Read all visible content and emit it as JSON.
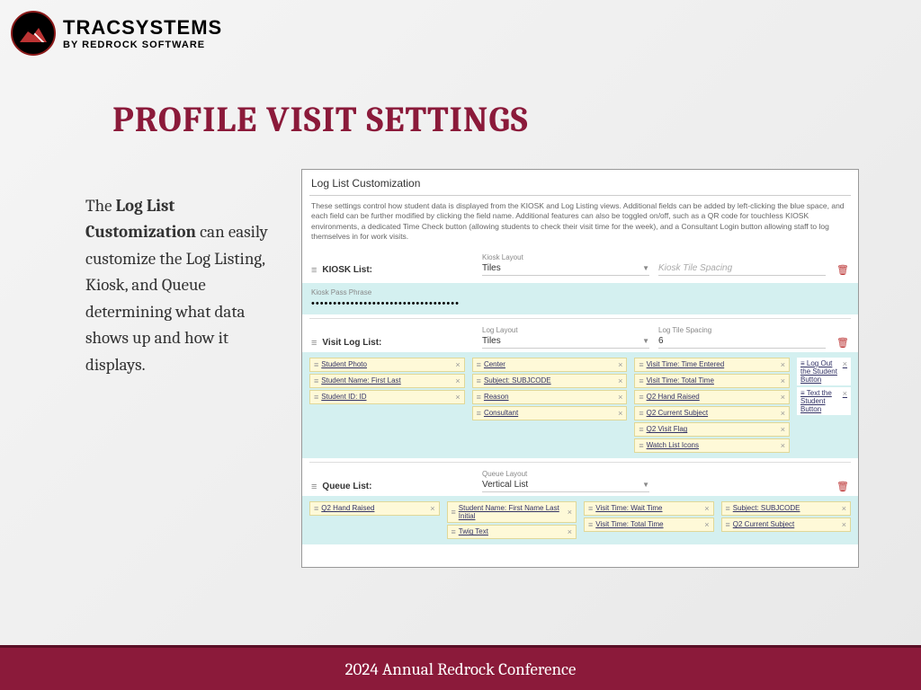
{
  "logo": {
    "main": "TRACSYSTEMS",
    "sub": "BY REDROCK SOFTWARE"
  },
  "title": "PROFILE VISIT SETTINGS",
  "body": {
    "pre": "The ",
    "bold": "Log List Customization",
    "post": " can easily customize the Log Listing, Kiosk, and Queue determining what data shows up and how it displays."
  },
  "panel": {
    "title": "Log List Customization",
    "desc": "These settings control how student data is displayed from the KIOSK and Log Listing views. Additional fields can be added by left-clicking the blue space, and each field can be further modified by clicking the field name. Additional features can also be toggled on/off, such as a QR code for touchless KIOSK environments, a dedicated Time Check button (allowing students to check their visit time for the week), and a Consultant Login button allowing staff to log themselves in for work visits.",
    "kiosk": {
      "label": "KIOSK List:",
      "layout_label": "Kiosk Layout",
      "layout_value": "Tiles",
      "spacing_label": "Kiosk Tile Spacing",
      "spacing_value": ""
    },
    "passphrase": {
      "label": "Kiosk Pass Phrase",
      "dots": "••••••••••••••••••••••••••••••••••"
    },
    "visitlog": {
      "label": "Visit Log List:",
      "layout_label": "Log Layout",
      "layout_value": "Tiles",
      "spacing_label": "Log Tile Spacing",
      "spacing_value": "6"
    },
    "visit_chips": {
      "col1": [
        "Student Photo",
        "Student Name: First Last",
        "Student ID: ID"
      ],
      "col2": [
        "Center",
        "Subject: SUBJCODE",
        "Reason",
        "Consultant"
      ],
      "col3": [
        "Visit Time: Time Entered",
        "Visit Time: Total Time",
        "Q2 Hand Raised",
        "Q2 Current Subject",
        "Q2 Visit Flag",
        "Watch List Icons"
      ],
      "col4": [
        "Log Out the Student Button",
        "Text the Student Button"
      ]
    },
    "queue": {
      "label": "Queue List:",
      "layout_label": "Queue Layout",
      "layout_value": "Vertical List"
    },
    "queue_chips": {
      "col1": [
        "Q2 Hand Raised"
      ],
      "col2": [
        "Student Name: First Name Last Initial",
        "Twig Text"
      ],
      "col3": [
        "Visit Time: Wait Time",
        "Visit Time: Total Time"
      ],
      "col4": [
        "Subject: SUBJCODE",
        "Q2 Current Subject"
      ]
    }
  },
  "footer": "2024 Annual Redrock Conference"
}
